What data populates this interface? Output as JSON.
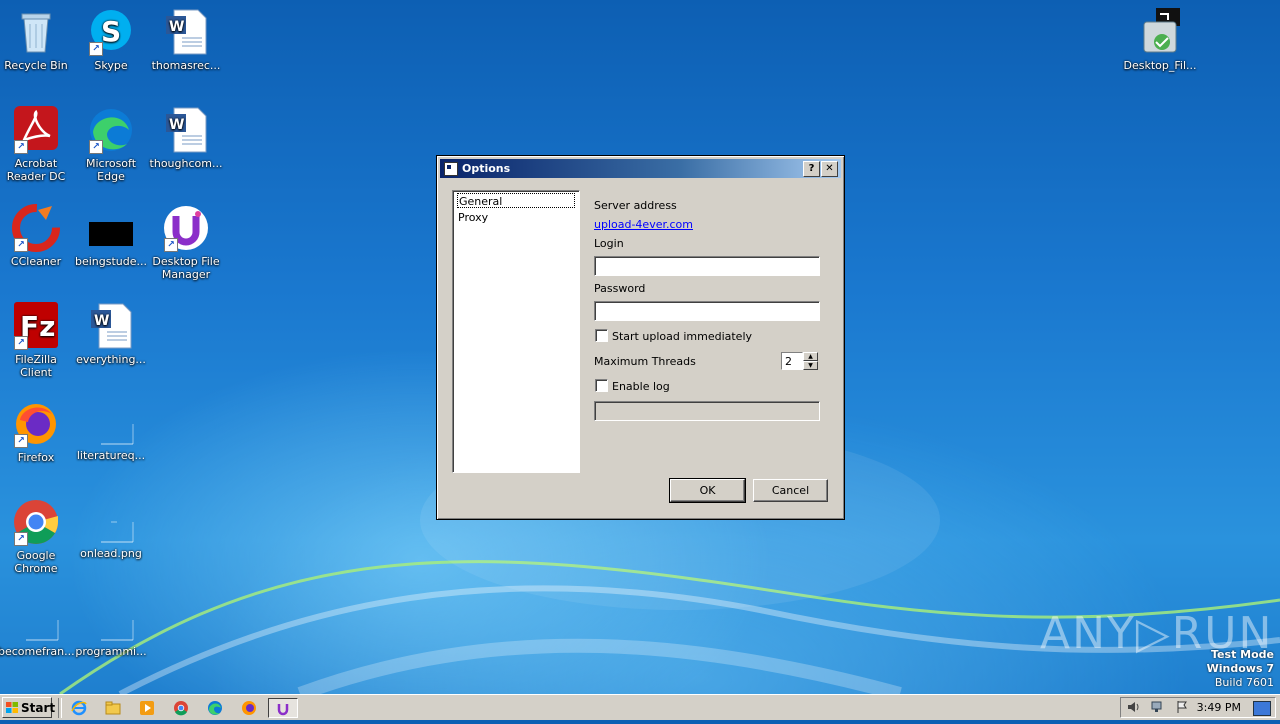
{
  "desktop": {
    "icons": [
      {
        "label": "Recycle Bin",
        "icon": "recycle-bin-icon"
      },
      {
        "label": "Skype",
        "icon": "skype-icon"
      },
      {
        "label": "thomasrec...",
        "icon": "word-document-icon"
      },
      {
        "label": "Acrobat Reader DC",
        "icon": "acrobat-icon"
      },
      {
        "label": "Microsoft Edge",
        "icon": "edge-icon"
      },
      {
        "label": "thoughcom...",
        "icon": "word-document-icon"
      },
      {
        "label": "CCleaner",
        "icon": "ccleaner-icon"
      },
      {
        "label": "beingstude...",
        "icon": "black-image-icon"
      },
      {
        "label": "Desktop File Manager",
        "icon": "desktop-file-manager-icon"
      },
      {
        "label": "FileZilla Client",
        "icon": "filezilla-icon"
      },
      {
        "label": "everything...",
        "icon": "word-document-icon"
      },
      {
        "label": "Firefox",
        "icon": "firefox-icon"
      },
      {
        "label": "literatureq...",
        "icon": "blank-file-icon"
      },
      {
        "label": "Google Chrome",
        "icon": "chrome-icon"
      },
      {
        "label": "onlead.png",
        "icon": "blank-file-icon"
      },
      {
        "label": "becomefran...",
        "icon": "blank-file-icon"
      },
      {
        "label": "programmi...",
        "icon": "blank-file-icon"
      },
      {
        "label": "Desktop_Fil...",
        "icon": "installer-icon"
      }
    ]
  },
  "dialog": {
    "title": "Options",
    "help_button": "?",
    "close_button": "✕",
    "nav_items": [
      "General",
      "Proxy"
    ],
    "server_address_label": "Server address",
    "server_address_value": "upload-4ever.com",
    "login_label": "Login",
    "login_value": "",
    "password_label": "Password",
    "password_value": "",
    "start_upload_label": "Start upload immediately",
    "start_upload_checked": false,
    "max_threads_label": "Maximum Threads",
    "max_threads_value": "2",
    "enable_log_label": "Enable log",
    "enable_log_checked": false,
    "log_path_value": "",
    "ok_label": "OK",
    "cancel_label": "Cancel"
  },
  "taskbar": {
    "start_label": "Start",
    "clock": "3:49 PM",
    "pinned": [
      "ie-icon",
      "explorer-icon",
      "media-player-icon",
      "chrome-icon",
      "edge-icon",
      "firefox-icon",
      "desktop-file-manager-icon"
    ]
  },
  "watermark": "ANY▷RUN",
  "system_info": {
    "line1": "Test Mode",
    "line2": "Windows 7",
    "line3": "Build 7601"
  }
}
